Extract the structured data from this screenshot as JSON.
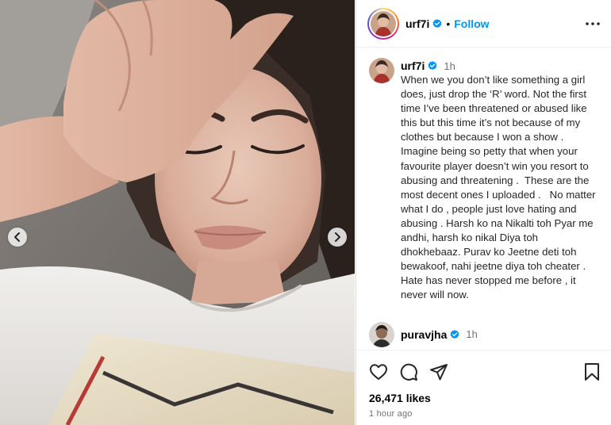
{
  "post": {
    "author": "urf7i",
    "follow_label": "Follow",
    "separator": "•",
    "more_icon": "more-horizontal-icon",
    "verified_icon": "verified-badge-icon"
  },
  "caption": {
    "username": "urf7i",
    "time": "1h",
    "text": "When we you don’t like something a girl does, just drop the ‘R’ word. Not the first time I’ve been threatened or abused like this but this time it’s not because of my clothes but because I won a show . Imagine being so petty that when your favourite player doesn’t win you resort to abusing and threatening .  These are the most decent ones I uploaded .   No matter what I do , people just love hating and abusing . Harsh ko na Nikalti toh Pyar me andhi, harsh ko nikal Diya toh dhokhebaaz. Purav ko Jeetne deti toh bewakoof, nahi jeetne diya toh cheater . Hate has never stopped me before , it never will now."
  },
  "comment": {
    "username": "puravjha",
    "time": "1h"
  },
  "actions": {
    "like_icon": "heart-icon",
    "comment_icon": "comment-icon",
    "share_icon": "share-icon",
    "save_icon": "bookmark-icon"
  },
  "stats": {
    "likes": "26,471 likes",
    "posted": "1 hour ago"
  },
  "carousel": {
    "prev_icon": "chevron-left-icon",
    "next_icon": "chevron-right-icon"
  },
  "colors": {
    "accent": "#0095f6",
    "secondary_text": "#737373",
    "verified": "#0095f6"
  }
}
